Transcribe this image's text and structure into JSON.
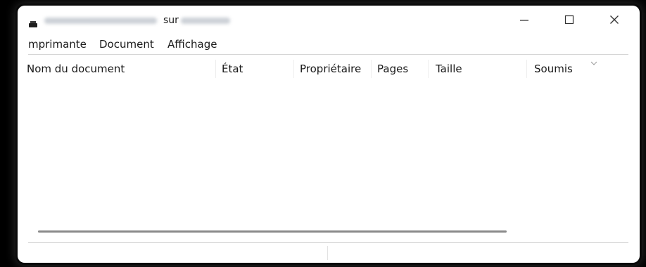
{
  "window": {
    "title_separator": "sur",
    "controls": {
      "minimize": "minimize-icon",
      "maximize": "maximize-icon",
      "close": "close-icon"
    }
  },
  "menu": [
    {
      "label": "mprimante"
    },
    {
      "label": "Document"
    },
    {
      "label": "Affichage"
    }
  ],
  "columns": [
    {
      "label": "Nom du document"
    },
    {
      "label": "État"
    },
    {
      "label": "Propriétaire"
    },
    {
      "label": "Pages"
    },
    {
      "label": "Taille"
    },
    {
      "label": "Soumis"
    }
  ],
  "queue": {
    "rows": []
  },
  "status": {
    "left": "",
    "right": ""
  },
  "colors": {
    "window_bg": "#ffffff",
    "outer_bg": "#000000",
    "text": "#1a1a1a",
    "scrollbar": "#8a8a8a"
  },
  "icons": {
    "app": "printer-icon",
    "sort": "chevron-down-icon"
  }
}
